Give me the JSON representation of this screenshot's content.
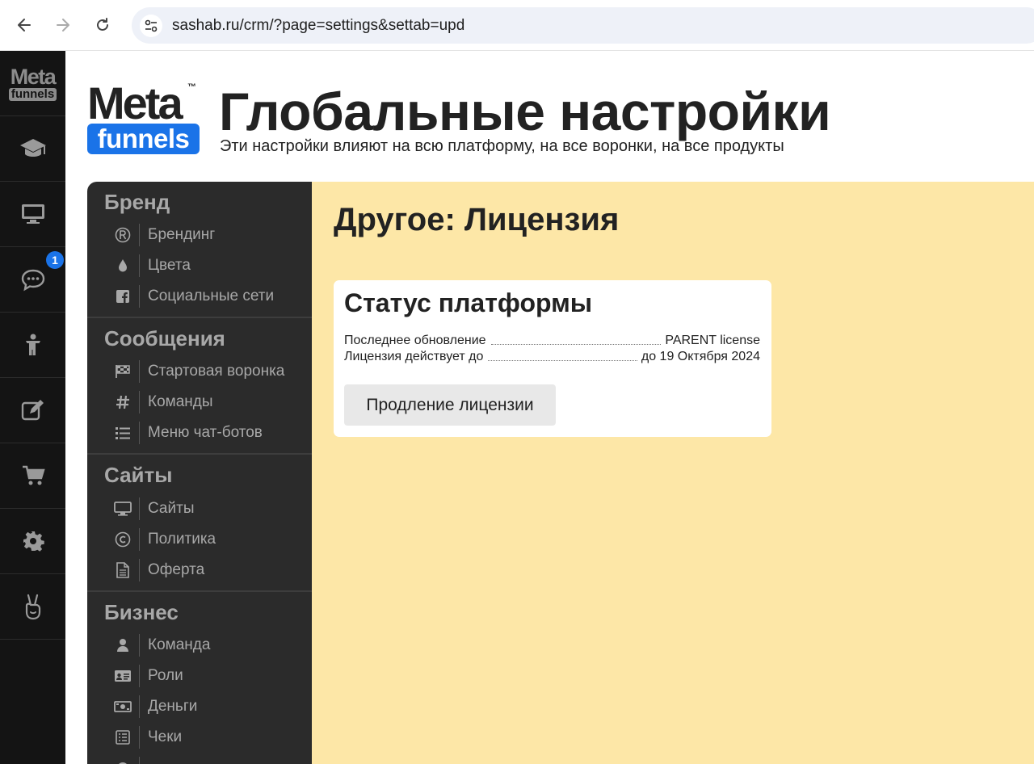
{
  "browser": {
    "url": "sashab.ru/crm/?page=settings&settab=upd"
  },
  "rail": {
    "logo_top": "Meta",
    "logo_bottom": "funnels",
    "items": [
      {
        "icon": "graduation-cap-icon"
      },
      {
        "icon": "monitor-icon"
      },
      {
        "icon": "chat-bubble-icon",
        "badge": "1"
      },
      {
        "icon": "child-figure-icon"
      },
      {
        "icon": "edit-icon"
      },
      {
        "icon": "cart-icon"
      },
      {
        "icon": "gear-icon"
      },
      {
        "icon": "peace-hand-icon"
      }
    ]
  },
  "header": {
    "logo_meta": "Meta",
    "logo_tm": "™",
    "logo_funnels": "funnels",
    "title": "Глобальные настройки",
    "subtitle": "Эти настройки влияют на всю платформу, на все воронки, на все продукты"
  },
  "settings_nav": {
    "sections": [
      {
        "heading": "Бренд",
        "items": [
          {
            "label": "Брендинг",
            "icon": "registered-icon"
          },
          {
            "label": "Цвета",
            "icon": "droplet-icon"
          },
          {
            "label": "Социальные сети",
            "icon": "facebook-icon"
          }
        ]
      },
      {
        "heading": "Сообщения",
        "items": [
          {
            "label": "Стартовая воронка",
            "icon": "flag-checkered-icon"
          },
          {
            "label": "Команды",
            "icon": "hashtag-icon"
          },
          {
            "label": "Меню чат-ботов",
            "icon": "list-icon"
          }
        ]
      },
      {
        "heading": "Сайты",
        "items": [
          {
            "label": "Сайты",
            "icon": "desktop-icon"
          },
          {
            "label": "Политика",
            "icon": "copyright-icon"
          },
          {
            "label": "Оферта",
            "icon": "document-icon"
          }
        ]
      },
      {
        "heading": "Бизнес",
        "items": [
          {
            "label": "Команда",
            "icon": "user-icon"
          },
          {
            "label": "Роли",
            "icon": "id-card-icon"
          },
          {
            "label": "Деньги",
            "icon": "money-bill-icon"
          },
          {
            "label": "Чеки",
            "icon": "receipt-icon"
          }
        ]
      }
    ]
  },
  "main": {
    "section_title": "Другое: Лицензия",
    "card": {
      "title": "Статус платформы",
      "rows": [
        {
          "key": "Последнее обновление",
          "value": "PARENT license"
        },
        {
          "key": "Лицензия действует до",
          "value": "до 19 Октября 2024"
        }
      ],
      "button_label": "Продление лицензии"
    }
  },
  "colors": {
    "accent": "#1a73e8",
    "sidebar_bg": "#2b2b2b",
    "rail_bg": "#141414",
    "content_bg": "#fde7a7"
  }
}
